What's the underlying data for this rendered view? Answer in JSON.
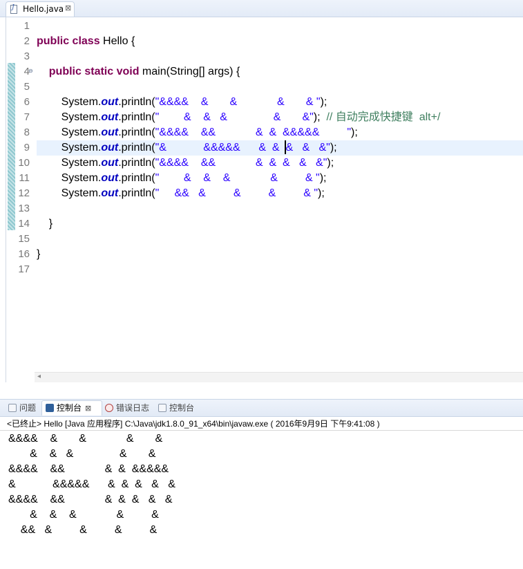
{
  "editor_tab": {
    "filename": "Hello.java",
    "close_glyph": "⊠"
  },
  "line_numbers": [
    "1",
    "2",
    "3",
    "4",
    "5",
    "6",
    "7",
    "8",
    "9",
    "10",
    "11",
    "12",
    "13",
    "14",
    "15",
    "16",
    "17"
  ],
  "code": {
    "line2": {
      "kw": "public class",
      "rest": " Hello {"
    },
    "line4": {
      "kw": "public static void",
      "rest": " main(String[] args) {"
    },
    "prints": [
      {
        "prefix": "System.",
        "field": "out",
        "method": ".println(",
        "string": "\"&&&&    &       &             &       & \"",
        "end": ");",
        "comment": ""
      },
      {
        "prefix": "System.",
        "field": "out",
        "method": ".println(",
        "string": "\"        &    &   &               &       &\"",
        "end": ");",
        "comment": "  // 自动完成快捷键  alt+/"
      },
      {
        "prefix": "System.",
        "field": "out",
        "method": ".println(",
        "string": "\"&&&&    &&             &  &  &&&&&         \"",
        "end": ");",
        "comment": ""
      },
      {
        "prefix": "System.",
        "field": "out",
        "method": ".println(",
        "string": "\"&            &&&&&      &  &  &   &   &\"",
        "end": ");",
        "comment": ""
      },
      {
        "prefix": "System.",
        "field": "out",
        "method": ".println(",
        "string": "\"&&&&    &&             &  &  &   &   &\"",
        "end": ");",
        "comment": ""
      },
      {
        "prefix": "System.",
        "field": "out",
        "method": ".println(",
        "string": "\"        &    &    &             &         & \"",
        "end": ");",
        "comment": ""
      },
      {
        "prefix": "System.",
        "field": "out",
        "method": ".println(",
        "string": "\"     &&   &         &         &         & \"",
        "end": ");",
        "comment": ""
      }
    ],
    "line14": "}",
    "line16": "}"
  },
  "views": {
    "tabs": [
      {
        "label": "问题",
        "icon": "problems-icon"
      },
      {
        "label": "控制台",
        "icon": "console-icon",
        "close": "⊠"
      },
      {
        "label": "错误日志",
        "icon": "error-log-icon"
      },
      {
        "label": "控制台",
        "icon": "console-icon"
      }
    ]
  },
  "console": {
    "header": "<已终止> Hello [Java 应用程序] C:\\Java\\jdk1.8.0_91_x64\\bin\\javaw.exe ( 2016年9月9日 下午9:41:08 )",
    "output": [
      "&&&&    &       &             &       &",
      "       &    &   &               &       &",
      "&&&&    &&             &  &  &&&&&",
      "&            &&&&&      &  &  &   &   &",
      "&&&&    &&             &  &  &   &   &",
      "       &    &    &             &         &",
      "    &&   &         &         &         &"
    ]
  }
}
